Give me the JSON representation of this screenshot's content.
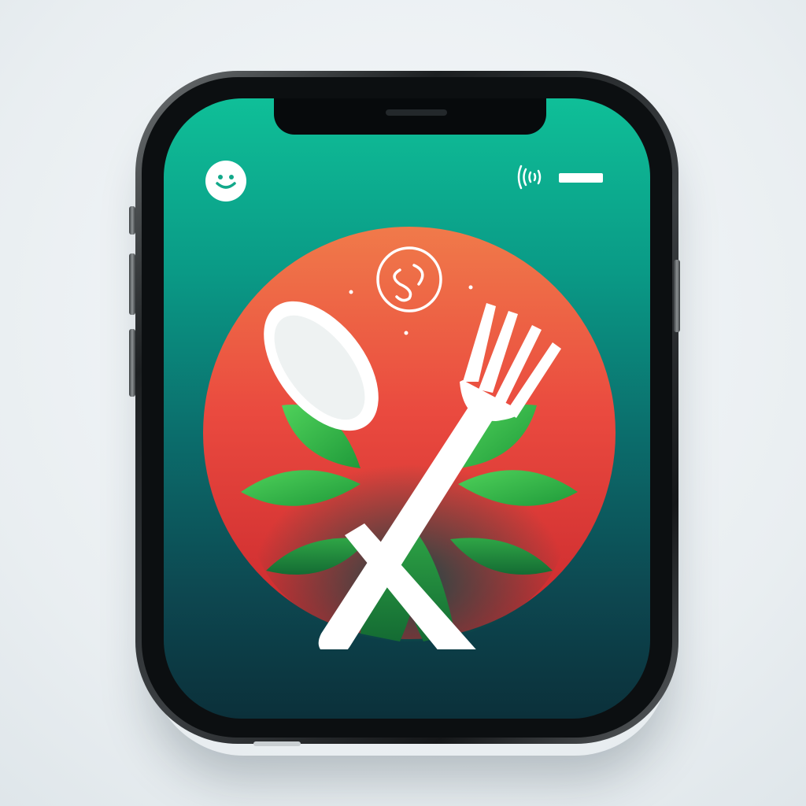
{
  "device": {
    "type": "smartphone",
    "frame_color": "#2a2e31",
    "screen_gradient_top": "#0fbf98",
    "screen_gradient_bottom": "#0b303a"
  },
  "status_bar": {
    "left_icon": "smiley-face-icon",
    "right_icons": [
      "nfc-signal-icon",
      "battery-icon"
    ]
  },
  "app_icon": {
    "badge_icon": "spiral-swirl-icon",
    "utensils": [
      "spoon-icon",
      "fork-icon"
    ],
    "decoration": "green-leaves",
    "circle_gradient_top": "#f07a4a",
    "circle_gradient_bottom": "#d92f32",
    "leaf_color": "#37c14a",
    "utensil_color": "#ffffff"
  }
}
